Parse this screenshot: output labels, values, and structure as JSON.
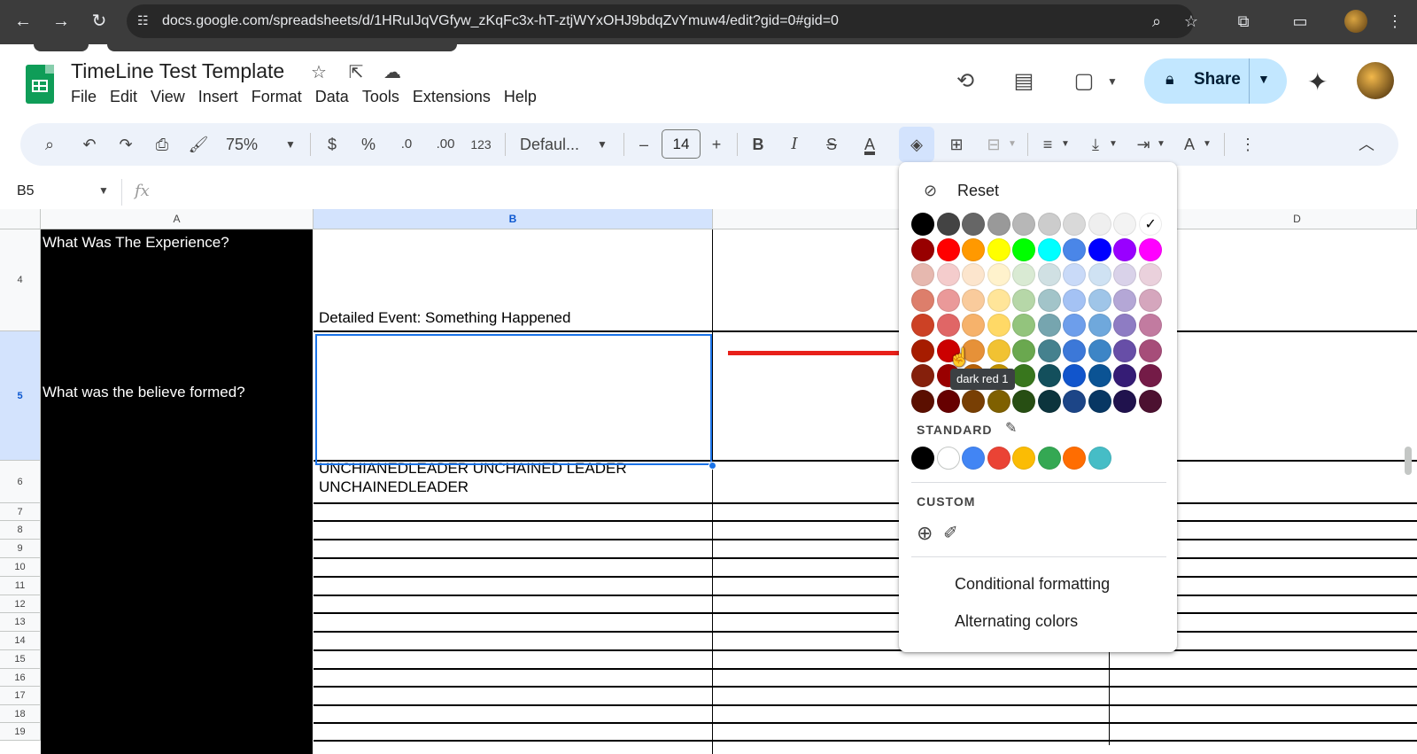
{
  "browser": {
    "url": "docs.google.com/spreadsheets/d/1HRuIJqVGfyw_zKqFc3x-hT-ztjWYxOHJ9bdqZvYmuw4/edit?gid=0#gid=0"
  },
  "doc": {
    "title": "TimeLine Test Template"
  },
  "menubar": [
    "File",
    "Edit",
    "View",
    "Insert",
    "Format",
    "Data",
    "Tools",
    "Extensions",
    "Help"
  ],
  "share": {
    "label": "Share"
  },
  "toolbar": {
    "zoom": "75%",
    "currency": "$",
    "percent": "%",
    "decrease_decimal": ".0",
    "increase_decimal": ".00",
    "number_format": "123",
    "font": "Defaul...",
    "font_size": "14",
    "minus": "–",
    "plus": "+",
    "bold": "B",
    "italic": "I",
    "text_color_glyph": "A"
  },
  "formula_bar": {
    "name_box": "B5",
    "fx": "fx"
  },
  "grid": {
    "columns": [
      "A",
      "B",
      "D"
    ],
    "selected_column": "B",
    "rows": [
      "4",
      "5",
      "6",
      "7",
      "8",
      "9",
      "10",
      "11",
      "12",
      "13",
      "14",
      "15",
      "16",
      "17",
      "18",
      "19"
    ],
    "selected_row": "5",
    "cells": {
      "A4": "What Was The Experience?",
      "A5": "What was the believe formed?",
      "B4": "Detailed Event: Something Happened",
      "B6_line1": "UNCHIANEDLEADER   UNCHAINED LEADER",
      "B6_line2": "UNCHAINEDLEADER"
    }
  },
  "color_menu": {
    "reset_label": "Reset",
    "palette": [
      [
        "#000000",
        "#434343",
        "#666666",
        "#999999",
        "#b7b7b7",
        "#cccccc",
        "#d9d9d9",
        "#efefef",
        "#f3f3f3",
        "#ffffff"
      ],
      [
        "#980000",
        "#ff0000",
        "#ff9900",
        "#ffff00",
        "#00ff00",
        "#00ffff",
        "#4a86e8",
        "#0000ff",
        "#9900ff",
        "#ff00ff"
      ],
      [
        "#e6b8af",
        "#f4cccc",
        "#fce5cd",
        "#fff2cc",
        "#d9ead3",
        "#d0e0e3",
        "#c9daf8",
        "#cfe2f3",
        "#d9d2e9",
        "#ead1dc"
      ],
      [
        "#dd7e6b",
        "#ea9999",
        "#f9cb9c",
        "#ffe599",
        "#b6d7a8",
        "#a2c4c9",
        "#a4c2f4",
        "#9fc5e8",
        "#b4a7d6",
        "#d5a6bd"
      ],
      [
        "#cc4125",
        "#e06666",
        "#f6b26b",
        "#ffd966",
        "#93c47d",
        "#76a5af",
        "#6d9eeb",
        "#6fa8dc",
        "#8e7cc3",
        "#c27ba0"
      ],
      [
        "#a61c00",
        "#cc0000",
        "#e69138",
        "#f1c232",
        "#6aa84f",
        "#45818e",
        "#3c78d8",
        "#3d85c6",
        "#674ea7",
        "#a64d79"
      ],
      [
        "#85200c",
        "#990000",
        "#b45f06",
        "#bf9000",
        "#38761d",
        "#134f5c",
        "#1155cc",
        "#0b5394",
        "#351c75",
        "#741b47"
      ],
      [
        "#5b0f00",
        "#660000",
        "#783f04",
        "#7f6000",
        "#274e13",
        "#0c343d",
        "#1c4587",
        "#073763",
        "#20124d",
        "#4c1130"
      ]
    ],
    "checked_color": "#ffffff",
    "tooltip": "dark red 1",
    "standard_label": "STANDARD",
    "standard_colors": [
      "#000000",
      "#ffffff",
      "#4285f4",
      "#ea4335",
      "#fbbc04",
      "#34a853",
      "#ff6d01",
      "#46bdc6"
    ],
    "custom_label": "CUSTOM",
    "conditional_formatting": "Conditional formatting",
    "alternating_colors": "Alternating colors"
  }
}
